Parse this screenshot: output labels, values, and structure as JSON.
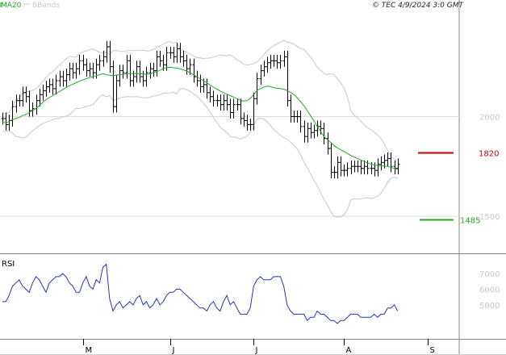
{
  "header": {
    "ma_label": "MA20",
    "bbands_label": "BBands",
    "credit": "© TEC 4/9/2024 3:0 GMT"
  },
  "colors": {
    "ma": "#22aa22",
    "bbands": "#c8c8c8",
    "bars": "#000000",
    "resistance": "#cc0000",
    "support": "#22aa22",
    "rsi": "#2233bb",
    "axis_text": "#c8c8c8"
  },
  "chart_data": [
    {
      "type": "ohlc",
      "panel": "price",
      "y_ticks": [
        {
          "value": 2000,
          "label": "2000"
        },
        {
          "value": 1500,
          "label": "1500"
        }
      ],
      "ylim": [
        1322,
        2528
      ],
      "levels": [
        {
          "name": "resistance",
          "value": 1820,
          "label": "1820",
          "color": "#cc0000"
        },
        {
          "name": "support",
          "value": 1485,
          "label": "1485",
          "color": "#22aa22"
        }
      ],
      "x_ticks": [
        "M",
        "J",
        "J",
        "A",
        "S"
      ],
      "x_tick_index": [
        24,
        50,
        75,
        102,
        127
      ],
      "close": [
        1990,
        1960,
        1980,
        2050,
        2080,
        2080,
        2120,
        2100,
        2030,
        2040,
        2080,
        2110,
        2130,
        2150,
        2160,
        2140,
        2180,
        2200,
        2180,
        2210,
        2240,
        2220,
        2240,
        2280,
        2260,
        2230,
        2240,
        2220,
        2260,
        2280,
        2300,
        2350,
        2250,
        2050,
        2180,
        2230,
        2220,
        2280,
        2180,
        2200,
        2250,
        2200,
        2180,
        2220,
        2240,
        2230,
        2300,
        2280,
        2260,
        2320,
        2320,
        2300,
        2340,
        2300,
        2280,
        2240,
        2260,
        2200,
        2180,
        2150,
        2160,
        2120,
        2100,
        2080,
        2080,
        2060,
        2080,
        2060,
        2020,
        2060,
        2060,
        1990,
        1980,
        1960,
        1960,
        2090,
        2190,
        2230,
        2250,
        2270,
        2280,
        2280,
        2270,
        2280,
        2300,
        2080,
        2000,
        2000,
        2000,
        1950,
        1900,
        1940,
        1920,
        1930,
        1950,
        1940,
        1890,
        1840,
        1720,
        1720,
        1770,
        1730,
        1730,
        1740,
        1750,
        1750,
        1750,
        1740,
        1750,
        1740,
        1740,
        1730,
        1760,
        1770,
        1780,
        1790,
        1750,
        1740,
        1760
      ],
      "ma20": [
        1970,
        1970,
        1975,
        1985,
        1990,
        1995,
        2005,
        2010,
        2020,
        2030,
        2040,
        2055,
        2070,
        2085,
        2095,
        2105,
        2115,
        2125,
        2135,
        2145,
        2155,
        2162,
        2170,
        2177,
        2184,
        2190,
        2195,
        2200,
        2205,
        2210,
        2215,
        2210,
        2208,
        2205,
        2208,
        2210,
        2212,
        2215,
        2215,
        2215,
        2216,
        2215,
        2213,
        2212,
        2213,
        2220,
        2225,
        2232,
        2240,
        2245,
        2248,
        2245,
        2243,
        2240,
        2235,
        2228,
        2220,
        2210,
        2200,
        2190,
        2180,
        2170,
        2158,
        2148,
        2138,
        2128,
        2120,
        2112,
        2105,
        2098,
        2090,
        2082,
        2078,
        2080,
        2090,
        2110,
        2130,
        2140,
        2148,
        2152,
        2150,
        2145,
        2142,
        2140,
        2138,
        2130,
        2122,
        2110,
        2095,
        2075,
        2055,
        2030,
        2005,
        1978,
        1950,
        1925,
        1900,
        1885,
        1870,
        1855,
        1843,
        1833,
        1825,
        1815,
        1805,
        1797,
        1790,
        1782,
        1775,
        1768,
        1762,
        1757,
        1755,
        1752,
        1752,
        1750,
        1745,
        1740,
        1735
      ]
    },
    {
      "type": "line",
      "panel": "rsi",
      "title": "RSI",
      "y_ticks": [
        {
          "value": 70,
          "label": "7000"
        },
        {
          "value": 60,
          "label": "6000"
        },
        {
          "value": 50,
          "label": "5000"
        }
      ],
      "ylim": [
        28.2,
        81.4
      ],
      "values": [
        52,
        52,
        56,
        62,
        64,
        66,
        62,
        60,
        58,
        64,
        68,
        66,
        62,
        58,
        64,
        66,
        68,
        68,
        70,
        68,
        64,
        62,
        58,
        58,
        64,
        68,
        62,
        60,
        66,
        64,
        74,
        76,
        54,
        46,
        50,
        52,
        48,
        50,
        52,
        50,
        54,
        56,
        50,
        52,
        48,
        50,
        54,
        50,
        52,
        56,
        58,
        58,
        60,
        60,
        58,
        56,
        54,
        52,
        50,
        48,
        48,
        46,
        50,
        52,
        48,
        46,
        52,
        56,
        50,
        52,
        48,
        44,
        44,
        44,
        48,
        62,
        66,
        68,
        66,
        66,
        66,
        68,
        68,
        68,
        62,
        50,
        46,
        44,
        44,
        44,
        44,
        40,
        42,
        42,
        46,
        44,
        44,
        42,
        40,
        40,
        38,
        40,
        40,
        42,
        44,
        44,
        44,
        42,
        42,
        42,
        42,
        44,
        42,
        44,
        44,
        48,
        48,
        50,
        46
      ]
    }
  ]
}
